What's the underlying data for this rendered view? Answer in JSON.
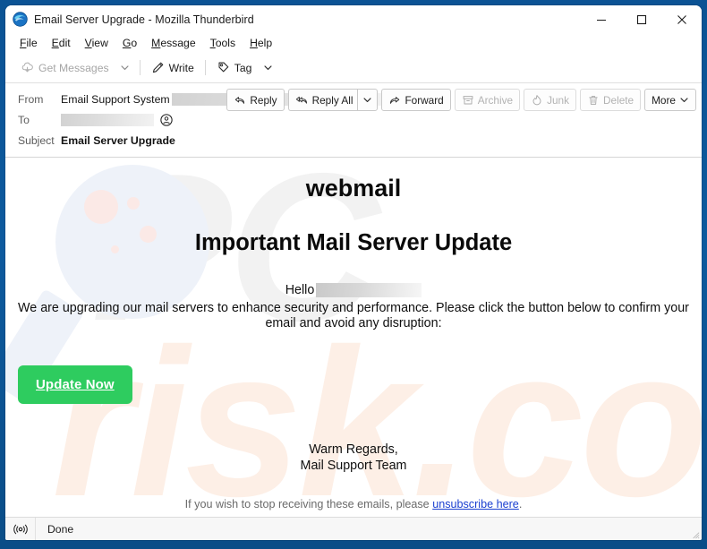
{
  "window": {
    "title": "Email Server Upgrade - Mozilla Thunderbird",
    "logo_icon": "thunderbird-logo-icon",
    "controls": {
      "minimize": "minimize-icon",
      "maximize": "maximize-icon",
      "close": "close-icon"
    }
  },
  "menubar": {
    "items": [
      {
        "label": "File",
        "mnemonic": "F"
      },
      {
        "label": "Edit",
        "mnemonic": "E"
      },
      {
        "label": "View",
        "mnemonic": "V"
      },
      {
        "label": "Go",
        "mnemonic": "G"
      },
      {
        "label": "Message",
        "mnemonic": "M"
      },
      {
        "label": "Tools",
        "mnemonic": "T"
      },
      {
        "label": "Help",
        "mnemonic": "H"
      }
    ]
  },
  "toolbar": {
    "get_messages": {
      "label": "Get Messages",
      "icon": "cloud-download-icon",
      "disabled": true
    },
    "get_messages_dropdown": {
      "icon": "chevron-down-icon"
    },
    "write": {
      "label": "Write",
      "icon": "pencil-icon"
    },
    "tag": {
      "label": "Tag",
      "icon": "tag-icon"
    },
    "tag_dropdown": {
      "icon": "chevron-down-icon"
    }
  },
  "message_header": {
    "from_label": "From",
    "from_value": "Email Support System",
    "from_address_redacted": true,
    "to_label": "To",
    "to_value_redacted": true,
    "subject_label": "Subject",
    "subject_value": "Email Server Upgrade",
    "contact_icon": "contact-circle-icon",
    "actions": {
      "reply": {
        "label": "Reply",
        "icon": "reply-icon",
        "disabled": false
      },
      "reply_all": {
        "label": "Reply All",
        "icon": "reply-all-icon",
        "disabled": false
      },
      "reply_all_dropdown": {
        "icon": "chevron-down-icon"
      },
      "forward": {
        "label": "Forward",
        "icon": "forward-icon",
        "disabled": false
      },
      "archive": {
        "label": "Archive",
        "icon": "archive-box-icon",
        "disabled": true
      },
      "junk": {
        "label": "Junk",
        "icon": "junk-flame-icon",
        "disabled": true
      },
      "delete": {
        "label": "Delete",
        "icon": "trash-icon",
        "disabled": true
      },
      "more": {
        "label": "More",
        "icon": "chevron-down-icon",
        "disabled": false
      }
    }
  },
  "email": {
    "brand": "webmail",
    "headline": "Important Mail Server Update",
    "greeting": "Hello",
    "greeting_name_redacted": true,
    "paragraph": "We are upgrading our mail servers to enhance security and performance. Please click the button below to confirm your email and avoid any disruption:",
    "cta_label": "Update Now",
    "cta_color": "#2ecc5f",
    "signoff_line1": "Warm Regards,",
    "signoff_line2": "Mail Support Team",
    "unsubscribe_prefix": "If you wish to stop receiving these emails, please ",
    "unsubscribe_link": "unsubscribe here",
    "unsubscribe_suffix": ".",
    "link_color": "#1a3fd0"
  },
  "watermark": {
    "text_part1": "PC",
    "text_part2": "risk.com",
    "magnifier_icon": "magnifying-glass-watermark-icon"
  },
  "statusbar": {
    "icon": "online-broadcast-icon",
    "text": "Done"
  }
}
